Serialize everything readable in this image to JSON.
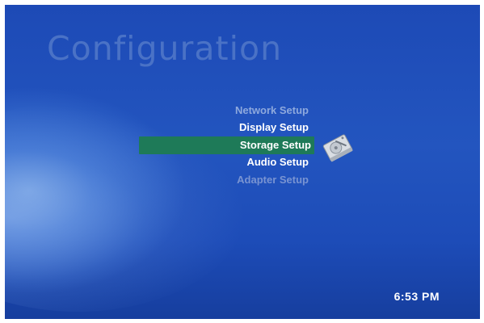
{
  "screen": {
    "title": "Configuration"
  },
  "menu": {
    "items": [
      {
        "label": "Network Setup",
        "state": "dim"
      },
      {
        "label": "Display Setup",
        "state": "normal"
      },
      {
        "label": "Storage Setup",
        "state": "selected"
      },
      {
        "label": "Audio Setup",
        "state": "normal"
      },
      {
        "label": "Adapter Setup",
        "state": "disabled"
      }
    ],
    "selected_icon": "hard-drive-icon",
    "highlight_color": "#1e7a58"
  },
  "status": {
    "time": "6:53 PM"
  },
  "colors": {
    "background": "#2355bf",
    "title": "#4a72c6",
    "text_bright": "#ffffff",
    "text_dim": "#8ea9dd"
  }
}
